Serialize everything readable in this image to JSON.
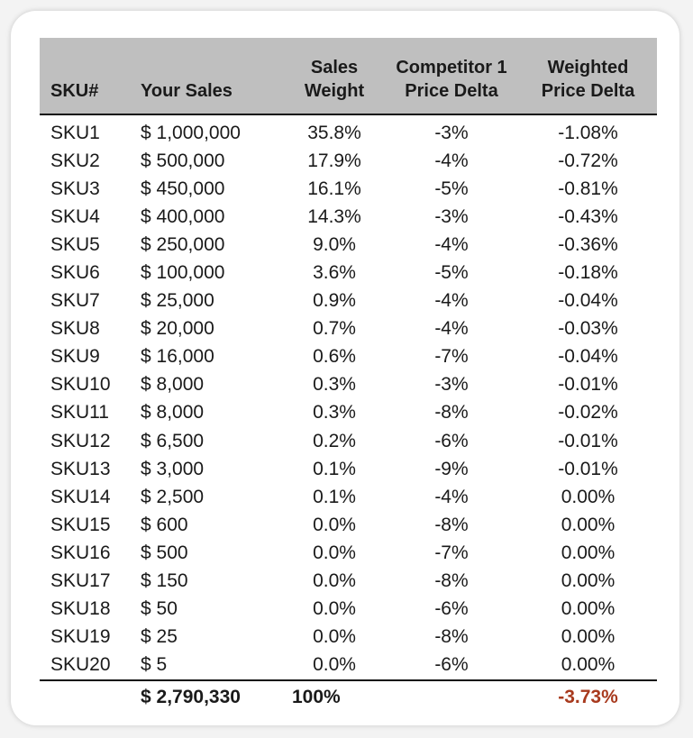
{
  "table": {
    "headers": {
      "sku": "SKU#",
      "sales": "Your Sales",
      "weight_line1": "Sales",
      "weight_line2": "Weight",
      "comp_line1": "Competitor 1",
      "comp_line2": "Price Delta",
      "wpd_line1": "Weighted",
      "wpd_line2": "Price Delta"
    },
    "rows": [
      {
        "sku": "SKU1",
        "sales": "$ 1,000,000",
        "weight": "35.8%",
        "comp": "-3%",
        "wpd": "-1.08%"
      },
      {
        "sku": "SKU2",
        "sales": "$ 500,000",
        "weight": "17.9%",
        "comp": "-4%",
        "wpd": "-0.72%"
      },
      {
        "sku": "SKU3",
        "sales": "$ 450,000",
        "weight": "16.1%",
        "comp": "-5%",
        "wpd": "-0.81%"
      },
      {
        "sku": "SKU4",
        "sales": "$ 400,000",
        "weight": "14.3%",
        "comp": "-3%",
        "wpd": "-0.43%"
      },
      {
        "sku": "SKU5",
        "sales": "$ 250,000",
        "weight": "9.0%",
        "comp": "-4%",
        "wpd": "-0.36%"
      },
      {
        "sku": "SKU6",
        "sales": "$ 100,000",
        "weight": "3.6%",
        "comp": "-5%",
        "wpd": "-0.18%"
      },
      {
        "sku": "SKU7",
        "sales": "$ 25,000",
        "weight": "0.9%",
        "comp": "-4%",
        "wpd": "-0.04%"
      },
      {
        "sku": "SKU8",
        "sales": "$ 20,000",
        "weight": "0.7%",
        "comp": "-4%",
        "wpd": "-0.03%"
      },
      {
        "sku": "SKU9",
        "sales": "$ 16,000",
        "weight": "0.6%",
        "comp": "-7%",
        "wpd": "-0.04%"
      },
      {
        "sku": "SKU10",
        "sales": "$ 8,000",
        "weight": "0.3%",
        "comp": "-3%",
        "wpd": "-0.01%"
      },
      {
        "sku": "SKU11",
        "sales": "$ 8,000",
        "weight": "0.3%",
        "comp": "-8%",
        "wpd": "-0.02%"
      },
      {
        "sku": "SKU12",
        "sales": "$ 6,500",
        "weight": "0.2%",
        "comp": "-6%",
        "wpd": "-0.01%"
      },
      {
        "sku": "SKU13",
        "sales": "$ 3,000",
        "weight": "0.1%",
        "comp": "-9%",
        "wpd": "-0.01%"
      },
      {
        "sku": "SKU14",
        "sales": "$ 2,500",
        "weight": "0.1%",
        "comp": "-4%",
        "wpd": "0.00%"
      },
      {
        "sku": "SKU15",
        "sales": "$ 600",
        "weight": "0.0%",
        "comp": "-8%",
        "wpd": "0.00%"
      },
      {
        "sku": "SKU16",
        "sales": "$ 500",
        "weight": "0.0%",
        "comp": "-7%",
        "wpd": "0.00%"
      },
      {
        "sku": "SKU17",
        "sales": "$ 150",
        "weight": "0.0%",
        "comp": "-8%",
        "wpd": "0.00%"
      },
      {
        "sku": "SKU18",
        "sales": "$ 50",
        "weight": "0.0%",
        "comp": "-6%",
        "wpd": "0.00%"
      },
      {
        "sku": "SKU19",
        "sales": "$ 25",
        "weight": "0.0%",
        "comp": "-8%",
        "wpd": "0.00%"
      },
      {
        "sku": "SKU20",
        "sales": "$ 5",
        "weight": "0.0%",
        "comp": "-6%",
        "wpd": "0.00%"
      }
    ],
    "totals": {
      "sku": "",
      "sales": "$ 2,790,330",
      "weight": "100%",
      "comp": "",
      "wpd": "-3.73%"
    }
  },
  "colors": {
    "header_bg": "#bfbfbf",
    "total_delta": "#a83a1e"
  }
}
